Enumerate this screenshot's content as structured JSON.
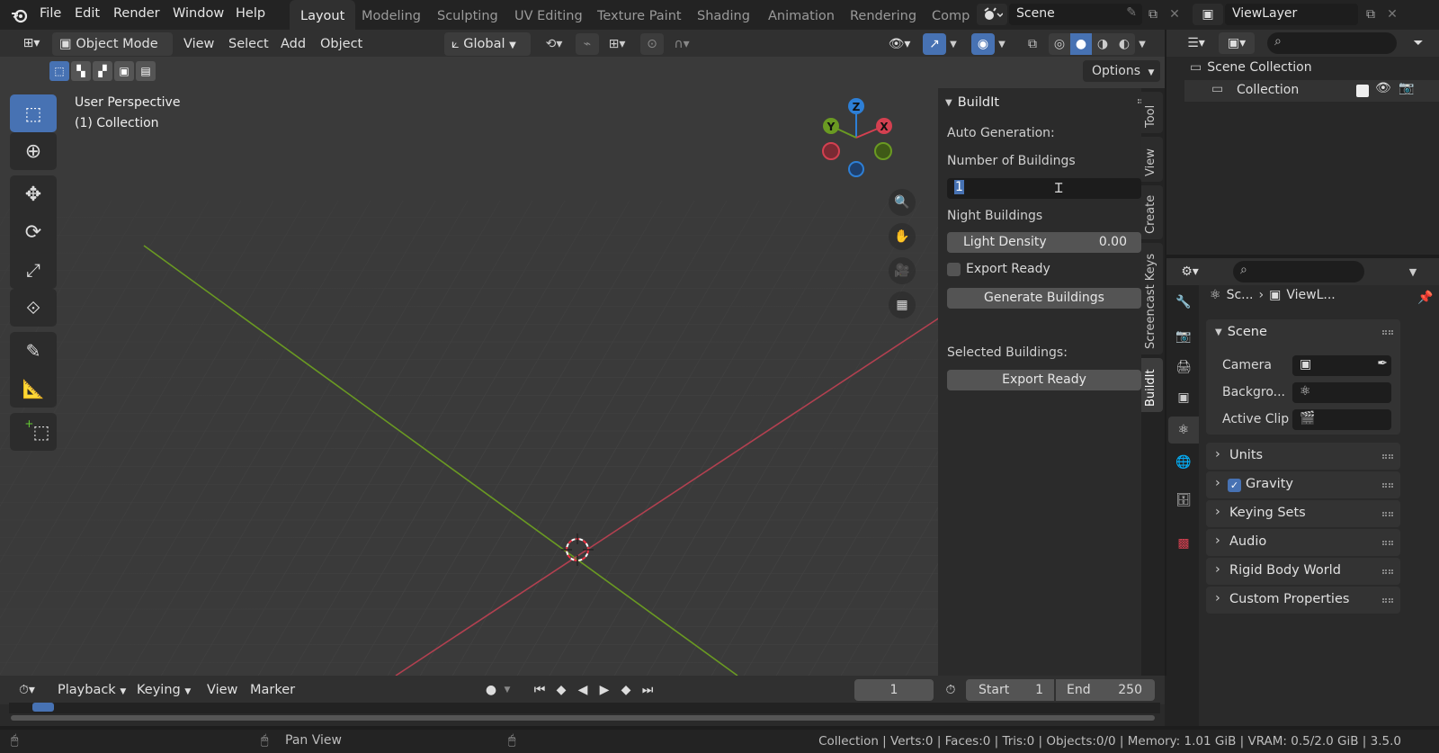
{
  "topbar": {
    "menu": [
      "File",
      "Edit",
      "Render",
      "Window",
      "Help"
    ],
    "workspaces": [
      "Layout",
      "Modeling",
      "Sculpting",
      "UV Editing",
      "Texture Paint",
      "Shading",
      "Animation",
      "Rendering",
      "Comp"
    ],
    "active_workspace": "Layout",
    "scene_name": "Scene",
    "view_layer": "ViewLayer"
  },
  "viewport_header": {
    "mode": "Object Mode",
    "menus": [
      "View",
      "Select",
      "Add",
      "Object"
    ],
    "transform_orientation": "Global",
    "options_label": "Options"
  },
  "viewport": {
    "perspective_label": "User Perspective",
    "collection_label": "(1) Collection",
    "gizmo_axes": {
      "x": "X",
      "y": "Y",
      "z": "Z"
    }
  },
  "buildit_panel": {
    "title": "BuildIt",
    "auto_generation_label": "Auto Generation:",
    "num_buildings_label": "Number of Buildings",
    "num_buildings_value": "1",
    "night_buildings_label": "Night Buildings",
    "light_density_label": "Light Density",
    "light_density_value": "0.00",
    "export_ready_checkbox_label": "Export Ready",
    "export_ready_checked": false,
    "generate_button": "Generate Buildings",
    "selected_buildings_label": "Selected Buildings:",
    "export_button": "Export Ready"
  },
  "side_tabs": [
    "Tool",
    "View",
    "Create",
    "Screencast Keys",
    "BuildIt"
  ],
  "outliner": {
    "scene_collection": "Scene Collection",
    "collection": "Collection"
  },
  "properties": {
    "breadcrumb_scene": "Sc...",
    "breadcrumb_viewlayer": "ViewL...",
    "scene_section": "Scene",
    "camera_label": "Camera",
    "background_label": "Backgro...",
    "active_clip_label": "Active Clip",
    "panels": [
      "Units",
      "Gravity",
      "Keying Sets",
      "Audio",
      "Rigid Body World",
      "Custom Properties"
    ],
    "gravity_checked": true
  },
  "timeline": {
    "menus": [
      "Playback",
      "Keying",
      "View",
      "Marker"
    ],
    "current_frame": "1",
    "start_label": "Start",
    "start_value": "1",
    "end_label": "End",
    "end_value": "250"
  },
  "statusbar": {
    "pan_view": "Pan View",
    "info": "Collection | Verts:0 | Faces:0 | Tris:0 | Objects:0/0 | Memory: 1.01 GiB | VRAM: 0.5/2.0 GiB | 3.5.0"
  },
  "colors": {
    "accent": "#4772b3",
    "x_axis": "#d44050",
    "y_axis": "#6a9a22",
    "z_axis": "#2d7fd6"
  }
}
